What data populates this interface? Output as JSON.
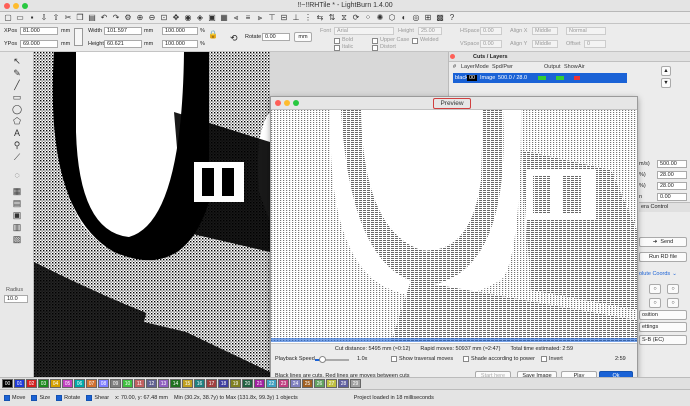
{
  "window": {
    "title": "!!~!!RHTile * - LightBurn 1.4.00"
  },
  "props": {
    "xpos_label": "XPos",
    "xpos_value": "81.000",
    "ypos_label": "YPos",
    "ypos_value": "69.000",
    "unit_mm": "mm",
    "width_label": "Width",
    "width_value": "101.597",
    "height_label": "Height",
    "height_value": "60.621",
    "pct_w": "100.000",
    "pct_h": "100.000",
    "pct_sign": "%",
    "rotate_label": "Rotate",
    "rotate_value": "0.00",
    "rotate_unit": "mm",
    "font_label": "Font",
    "font_value": "Arial",
    "fheight_label": "Height",
    "fheight_value": "25.00",
    "hspace_label": "HSpace",
    "hspace_value": "0.00",
    "vspace_label": "VSpace",
    "vspace_value": "0.00",
    "alignx_label": "Align X",
    "alignx_value": "Middle",
    "aligny_label": "Align Y",
    "aligny_value": "Middle",
    "normal_value": "Normal",
    "offset_label": "Offset",
    "offset_value": "0",
    "bold": "Bold",
    "italic": "Italic",
    "upper": "Upper Case",
    "welded": "Welded",
    "distort": "Distort"
  },
  "cuts": {
    "title": "Cuts / Layers",
    "headers": [
      "#",
      "Layer",
      "Mode",
      "Spd/Pwr",
      "Output",
      "Show",
      "Air"
    ],
    "rows": [
      {
        "num": "",
        "layer": "black",
        "mode_num": "00",
        "mode": "Image",
        "spdpwr": "500.0 / 28.0"
      }
    ],
    "side_values": [
      "500.00",
      "28.00",
      "28.00",
      "0.00"
    ],
    "side_labels": [
      "m/s)",
      "%)",
      "%)",
      "n"
    ],
    "camera_label": "era Control"
  },
  "laser": {
    "send": "Send",
    "run_rd": "Run RD file",
    "coords": "olute Coords",
    "position": "osition",
    "settings": "ettings",
    "device": "S-B (EC)"
  },
  "preview": {
    "title": "Preview",
    "stats": {
      "cut_distance": "Cut distance: 5495 mm (≈0:12)",
      "rapid_moves": "Rapid moves: 50937 mm (≈2:47)",
      "total_time": "Total time estimated: 2:59"
    },
    "playback_label": "Playback Speed",
    "playback_value": "1.0x",
    "time_value": "2:59",
    "playback_level": 0.22,
    "show_traversal": "Show traversal moves",
    "shade_power": "Shade according to power",
    "invert": "Invert",
    "legend": "Black lines are cuts, Red lines are moves between cuts",
    "start_here": "Start here",
    "save_image": "Save Image",
    "play": "Play",
    "ok": "Ok"
  },
  "palette": [
    "00",
    "01",
    "02",
    "03",
    "04",
    "05",
    "06",
    "07",
    "08",
    "09",
    "10",
    "11",
    "12",
    "13",
    "14",
    "15",
    "16",
    "17",
    "18",
    "19",
    "20",
    "21",
    "22",
    "23",
    "24",
    "25",
    "26",
    "27",
    "28",
    "29"
  ],
  "palette_colors": [
    "#000000",
    "#1f3ad8",
    "#d42020",
    "#1e8a1e",
    "#d4a000",
    "#c040c0",
    "#00a8a8",
    "#d07030",
    "#7f7fff",
    "#7f7f7f",
    "#40c040",
    "#c06060",
    "#606090",
    "#9060c0",
    "#207020",
    "#c0a020",
    "#208080",
    "#a04040",
    "#4040a0",
    "#808020",
    "#206040",
    "#a020a0",
    "#40a0c0",
    "#c04080",
    "#8080c0",
    "#a06020",
    "#60a060",
    "#c0c040",
    "#6060a0",
    "#a0a0a0"
  ],
  "status": {
    "move": "Move",
    "size": "Size",
    "rotate": "Rotate",
    "shear": "Shear",
    "coords": "x: 70.00, y: 67.48 mm",
    "bounds": "Min (30.2x, 38.7y) to Max (131.8x, 99.3y)  1 objects",
    "message": "Project loaded in 18 milliseconds"
  },
  "left_tools": {
    "radius_label": "Radius",
    "radius_value": "10.0"
  }
}
